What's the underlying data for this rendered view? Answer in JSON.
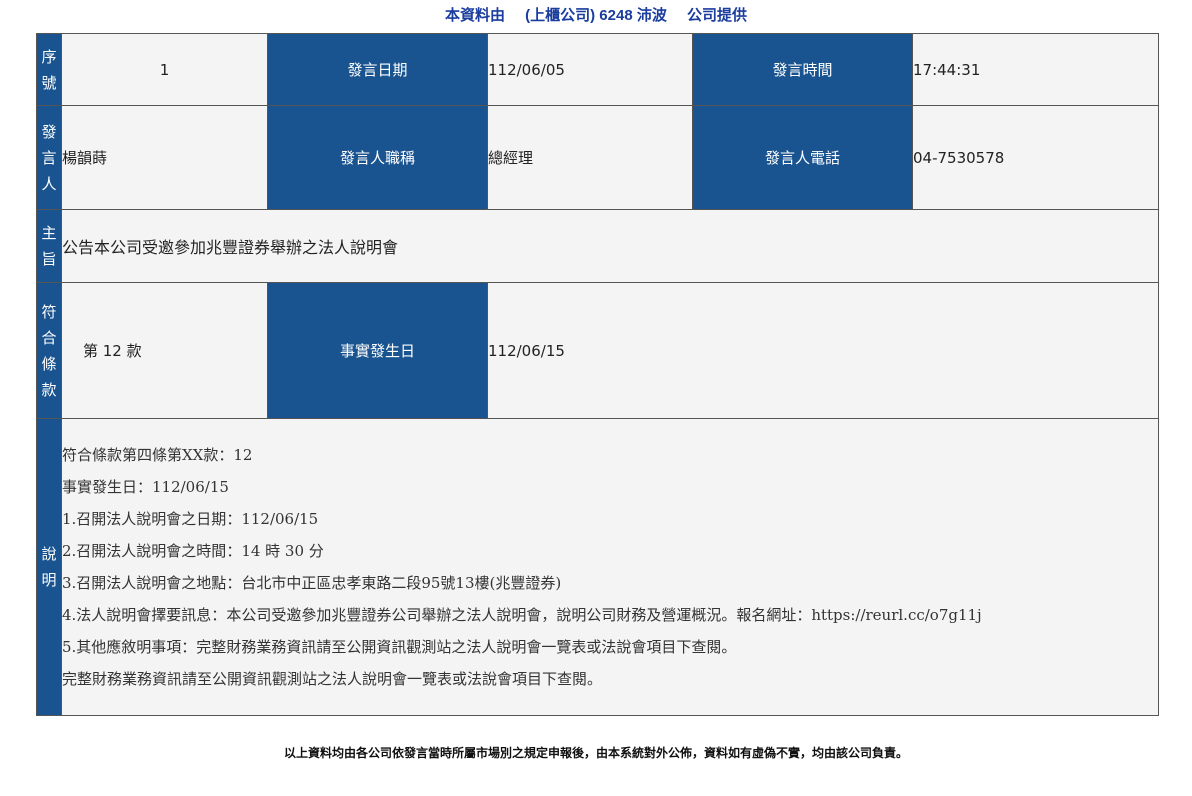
{
  "header": {
    "prefix": "本資料由",
    "company": "(上櫃公司) 6248 沛波",
    "suffix": "公司提供"
  },
  "row1": {
    "side": "序號",
    "seq": "1",
    "date_label": "發言日期",
    "date": "112/06/05",
    "time_label": "發言時間",
    "time": "17:44:31"
  },
  "row2": {
    "side": "發言人",
    "speaker": "楊韻蒔",
    "title_label": "發言人職稱",
    "title": "總經理",
    "phone_label": "發言人電話",
    "phone": "04-7530578"
  },
  "row3": {
    "side": "主旨",
    "subject": "公告本公司受邀參加兆豐證券舉辦之法人說明會"
  },
  "row4": {
    "side": "符合條款",
    "clause": "第 12 款",
    "fact_label": "事實發生日",
    "fact_date": "112/06/15"
  },
  "row5": {
    "side": "說明",
    "lines": [
      "符合條款第四條第XX款：12",
      "事實發生日：112/06/15",
      "1.召開法人說明會之日期：112/06/15",
      "2.召開法人說明會之時間：14 時 30 分",
      "3.召開法人說明會之地點：台北市中正區忠孝東路二段95號13樓(兆豐證券)",
      "4.法人說明會擇要訊息：本公司受邀參加兆豐證券公司舉辦之法人說明會，說明公司財務及營運概況。報名網址：https://reurl.cc/o7g11j",
      "5.其他應敘明事項：完整財務業務資訊請至公開資訊觀測站之法人說明會一覽表或法說會項目下查閱。",
      "完整財務業務資訊請至公開資訊觀測站之法人說明會一覽表或法說會項目下查閱。"
    ]
  },
  "footer": "以上資料均由各公司依發言當時所屬市場別之規定申報後，由本系統對外公佈，資料如有虛偽不實，均由該公司負責。"
}
